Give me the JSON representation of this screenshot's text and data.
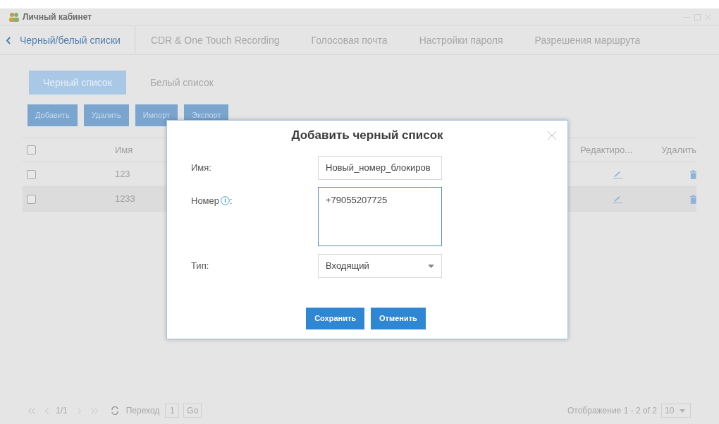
{
  "window": {
    "title": "Личный кабинет"
  },
  "tabs": [
    {
      "label": "Черный/белый списки",
      "selected": true
    },
    {
      "label": "CDR & One Touch Recording",
      "selected": false
    },
    {
      "label": "Голосовая почта",
      "selected": false
    },
    {
      "label": "Настройки пароля",
      "selected": false
    },
    {
      "label": "Разрешения маршрута",
      "selected": false
    }
  ],
  "subtabs": [
    {
      "label": "Черный список",
      "selected": true
    },
    {
      "label": "Белый список",
      "selected": false
    }
  ],
  "toolbar": [
    "Добавить",
    "Удалить",
    "Импорт",
    "Экспорт"
  ],
  "table": {
    "header_checked": false,
    "columns": [
      "Имя",
      "Редактиро...",
      "Удалить"
    ],
    "rows": [
      {
        "checked": false,
        "name": "123"
      },
      {
        "checked": false,
        "name": "1233"
      }
    ]
  },
  "dialog": {
    "title": "Добавить черный список",
    "name_label": "Имя:",
    "name_value": "Новый_номер_блокиров",
    "number_label": "Номер",
    "number_suffix": ":",
    "number_value": "+79055207725",
    "type_label": "Тип:",
    "type_value": "Входящий",
    "buttons": [
      "Сохранить",
      "Отменить"
    ]
  },
  "pagination": {
    "page": "1/1",
    "goto_label": "Переход",
    "goto_value": "1",
    "go": "Go",
    "summary": "Отображение 1 - 2 of 2",
    "page_size": "10"
  }
}
